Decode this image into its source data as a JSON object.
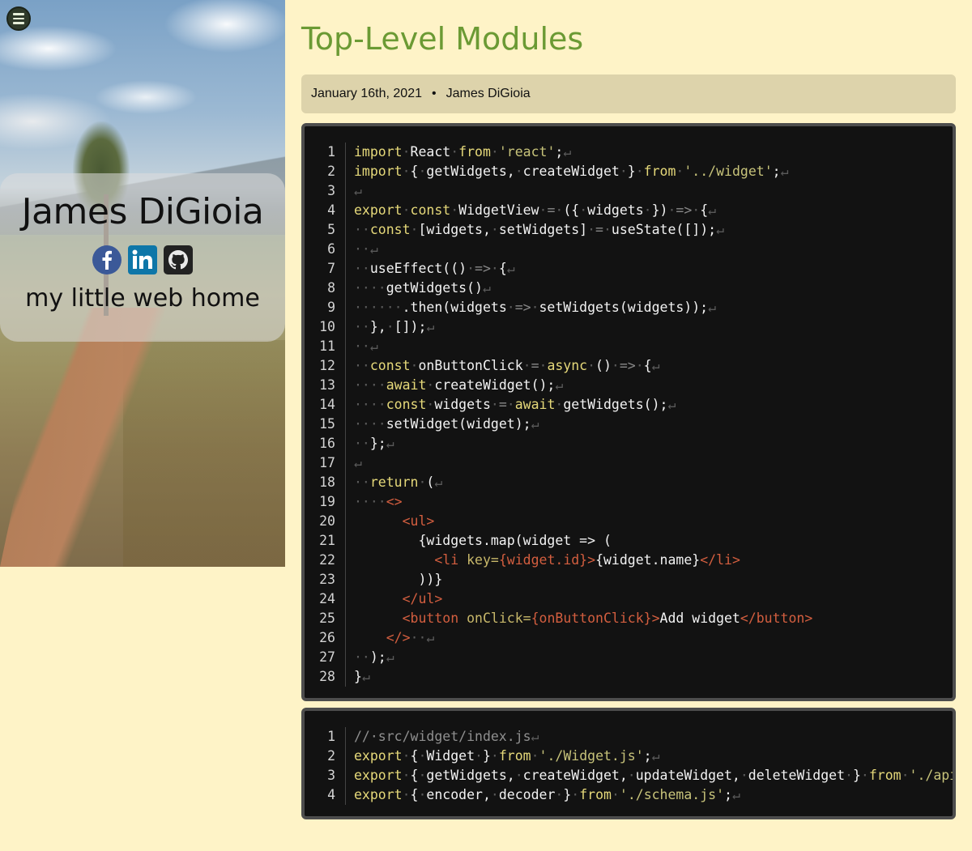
{
  "sidebar": {
    "name": "James DiGioia",
    "tagline": "my little web home",
    "social": [
      {
        "icon": "facebook-icon",
        "color": "#3b5998"
      },
      {
        "icon": "linkedin-icon",
        "color": "#0e76a8"
      },
      {
        "icon": "github-icon",
        "color": "#222222"
      }
    ]
  },
  "header": {
    "title": "Top-Level Modules",
    "date": "January 16th, 2021",
    "separator": "•",
    "author": "James DiGioia"
  },
  "code_blocks": [
    {
      "lines": [
        {
          "n": "1",
          "html": "<span class='kw'>import</span><span class='ws'>·</span>React<span class='ws'>·</span><span class='kw'>from</span><span class='ws'>·</span><span class='str'>'react'</span>;<span class='ws'>↵</span>"
        },
        {
          "n": "2",
          "html": "<span class='kw'>import</span><span class='ws'>·</span>{<span class='ws'>·</span>getWidgets,<span class='ws'>·</span>createWidget<span class='ws'>·</span>}<span class='ws'>·</span><span class='kw'>from</span><span class='ws'>·</span><span class='str'>'../widget'</span>;<span class='ws'>↵</span>"
        },
        {
          "n": "3",
          "html": "<span class='ws'>↵</span>"
        },
        {
          "n": "4",
          "html": "<span class='kw'>export</span><span class='ws'>·</span><span class='kw'>const</span><span class='ws'>·</span>WidgetView<span class='ws'>·</span><span class='op'>=</span><span class='ws'>·</span>({<span class='ws'>·</span>widgets<span class='ws'>·</span>})<span class='ws'>·</span><span class='op'>=&gt;</span><span class='ws'>·</span>{<span class='ws'>↵</span>"
        },
        {
          "n": "5",
          "html": "<span class='ws'>··</span><span class='kw'>const</span><span class='ws'>·</span>[widgets,<span class='ws'>·</span>setWidgets]<span class='ws'>·</span><span class='op'>=</span><span class='ws'>·</span>useState([]);<span class='ws'>↵</span>"
        },
        {
          "n": "6",
          "html": "<span class='ws'>··↵</span>"
        },
        {
          "n": "7",
          "html": "<span class='ws'>··</span>useEffect(()<span class='ws'>·</span><span class='op'>=&gt;</span><span class='ws'>·</span>{<span class='ws'>↵</span>"
        },
        {
          "n": "8",
          "html": "<span class='ws'>····</span>getWidgets()<span class='ws'>↵</span>"
        },
        {
          "n": "9",
          "html": "<span class='ws'>······</span>.then(widgets<span class='ws'>·</span><span class='op'>=&gt;</span><span class='ws'>·</span>setWidgets(widgets));<span class='ws'>↵</span>"
        },
        {
          "n": "10",
          "html": "<span class='ws'>··</span>},<span class='ws'>·</span>[]);<span class='ws'>↵</span>"
        },
        {
          "n": "11",
          "html": "<span class='ws'>··↵</span>"
        },
        {
          "n": "12",
          "html": "<span class='ws'>··</span><span class='kw'>const</span><span class='ws'>·</span>onButtonClick<span class='ws'>·</span><span class='op'>=</span><span class='ws'>·</span><span class='kw'>async</span><span class='ws'>·</span>()<span class='ws'>·</span><span class='op'>=&gt;</span><span class='ws'>·</span>{<span class='ws'>↵</span>"
        },
        {
          "n": "13",
          "html": "<span class='ws'>····</span><span class='kw'>await</span><span class='ws'>·</span>createWidget();<span class='ws'>↵</span>"
        },
        {
          "n": "14",
          "html": "<span class='ws'>····</span><span class='kw'>const</span><span class='ws'>·</span>widgets<span class='ws'>·</span><span class='op'>=</span><span class='ws'>·</span><span class='kw'>await</span><span class='ws'>·</span>getWidgets();<span class='ws'>↵</span>"
        },
        {
          "n": "15",
          "html": "<span class='ws'>····</span>setWidget(widget);<span class='ws'>↵</span>"
        },
        {
          "n": "16",
          "html": "<span class='ws'>··</span>};<span class='ws'>↵</span>"
        },
        {
          "n": "17",
          "html": "<span class='ws'>↵</span>"
        },
        {
          "n": "18",
          "html": "<span class='ws'>··</span><span class='kw'>return</span><span class='ws'>·</span>(<span class='ws'>↵</span>"
        },
        {
          "n": "19",
          "html": "<span class='ws'>····</span><span class='tag'>&lt;&gt;</span>"
        },
        {
          "n": "20",
          "html": "      <span class='tag'>&lt;ul&gt;</span>"
        },
        {
          "n": "21",
          "html": "        {widgets.map(widget =&gt; ("
        },
        {
          "n": "22",
          "html": "          <span class='tag'>&lt;li</span> <span class='attr'>key=</span><span class='tag'>{widget.id}</span><span class='tag'>&gt;</span>{widget.name}<span class='tag'>&lt;/li&gt;</span>"
        },
        {
          "n": "23",
          "html": "        ))}"
        },
        {
          "n": "24",
          "html": "      <span class='tag'>&lt;/ul&gt;</span>"
        },
        {
          "n": "25",
          "html": "      <span class='tag'>&lt;button</span> <span class='attr'>onClick=</span><span class='tag'>{onButtonClick}</span><span class='tag'>&gt;</span>Add widget<span class='tag'>&lt;/button&gt;</span>"
        },
        {
          "n": "26",
          "html": "    <span class='tag'>&lt;/&gt;</span><span class='ws'>··↵</span>"
        },
        {
          "n": "27",
          "html": "<span class='ws'>··</span>);<span class='ws'>↵</span>"
        },
        {
          "n": "28",
          "html": "}<span class='ws'>↵</span>"
        }
      ]
    },
    {
      "lines": [
        {
          "n": "1",
          "html": "<span class='cm'>//·src/widget/index.js</span><span class='ws'>↵</span>"
        },
        {
          "n": "2",
          "html": "<span class='kw'>export</span><span class='ws'>·</span>{<span class='ws'>·</span>Widget<span class='ws'>·</span>}<span class='ws'>·</span><span class='kw'>from</span><span class='ws'>·</span><span class='str'>'./Widget.js'</span>;<span class='ws'>↵</span>"
        },
        {
          "n": "3",
          "html": "<span class='kw'>export</span><span class='ws'>·</span>{<span class='ws'>·</span>getWidgets,<span class='ws'>·</span>createWidget,<span class='ws'>·</span>updateWidget,<span class='ws'>·</span>deleteWidget<span class='ws'>·</span>}<span class='ws'>·</span><span class='kw'>from</span><span class='ws'>·</span><span class='str'>'./api.js'</span>;<span class='ws'>↵</span>"
        },
        {
          "n": "4",
          "html": "<span class='kw'>export</span><span class='ws'>·</span>{<span class='ws'>·</span>encoder,<span class='ws'>·</span>decoder<span class='ws'>·</span>}<span class='ws'>·</span><span class='kw'>from</span><span class='ws'>·</span><span class='str'>'./schema.js'</span>;<span class='ws'>↵</span>"
        }
      ]
    }
  ]
}
